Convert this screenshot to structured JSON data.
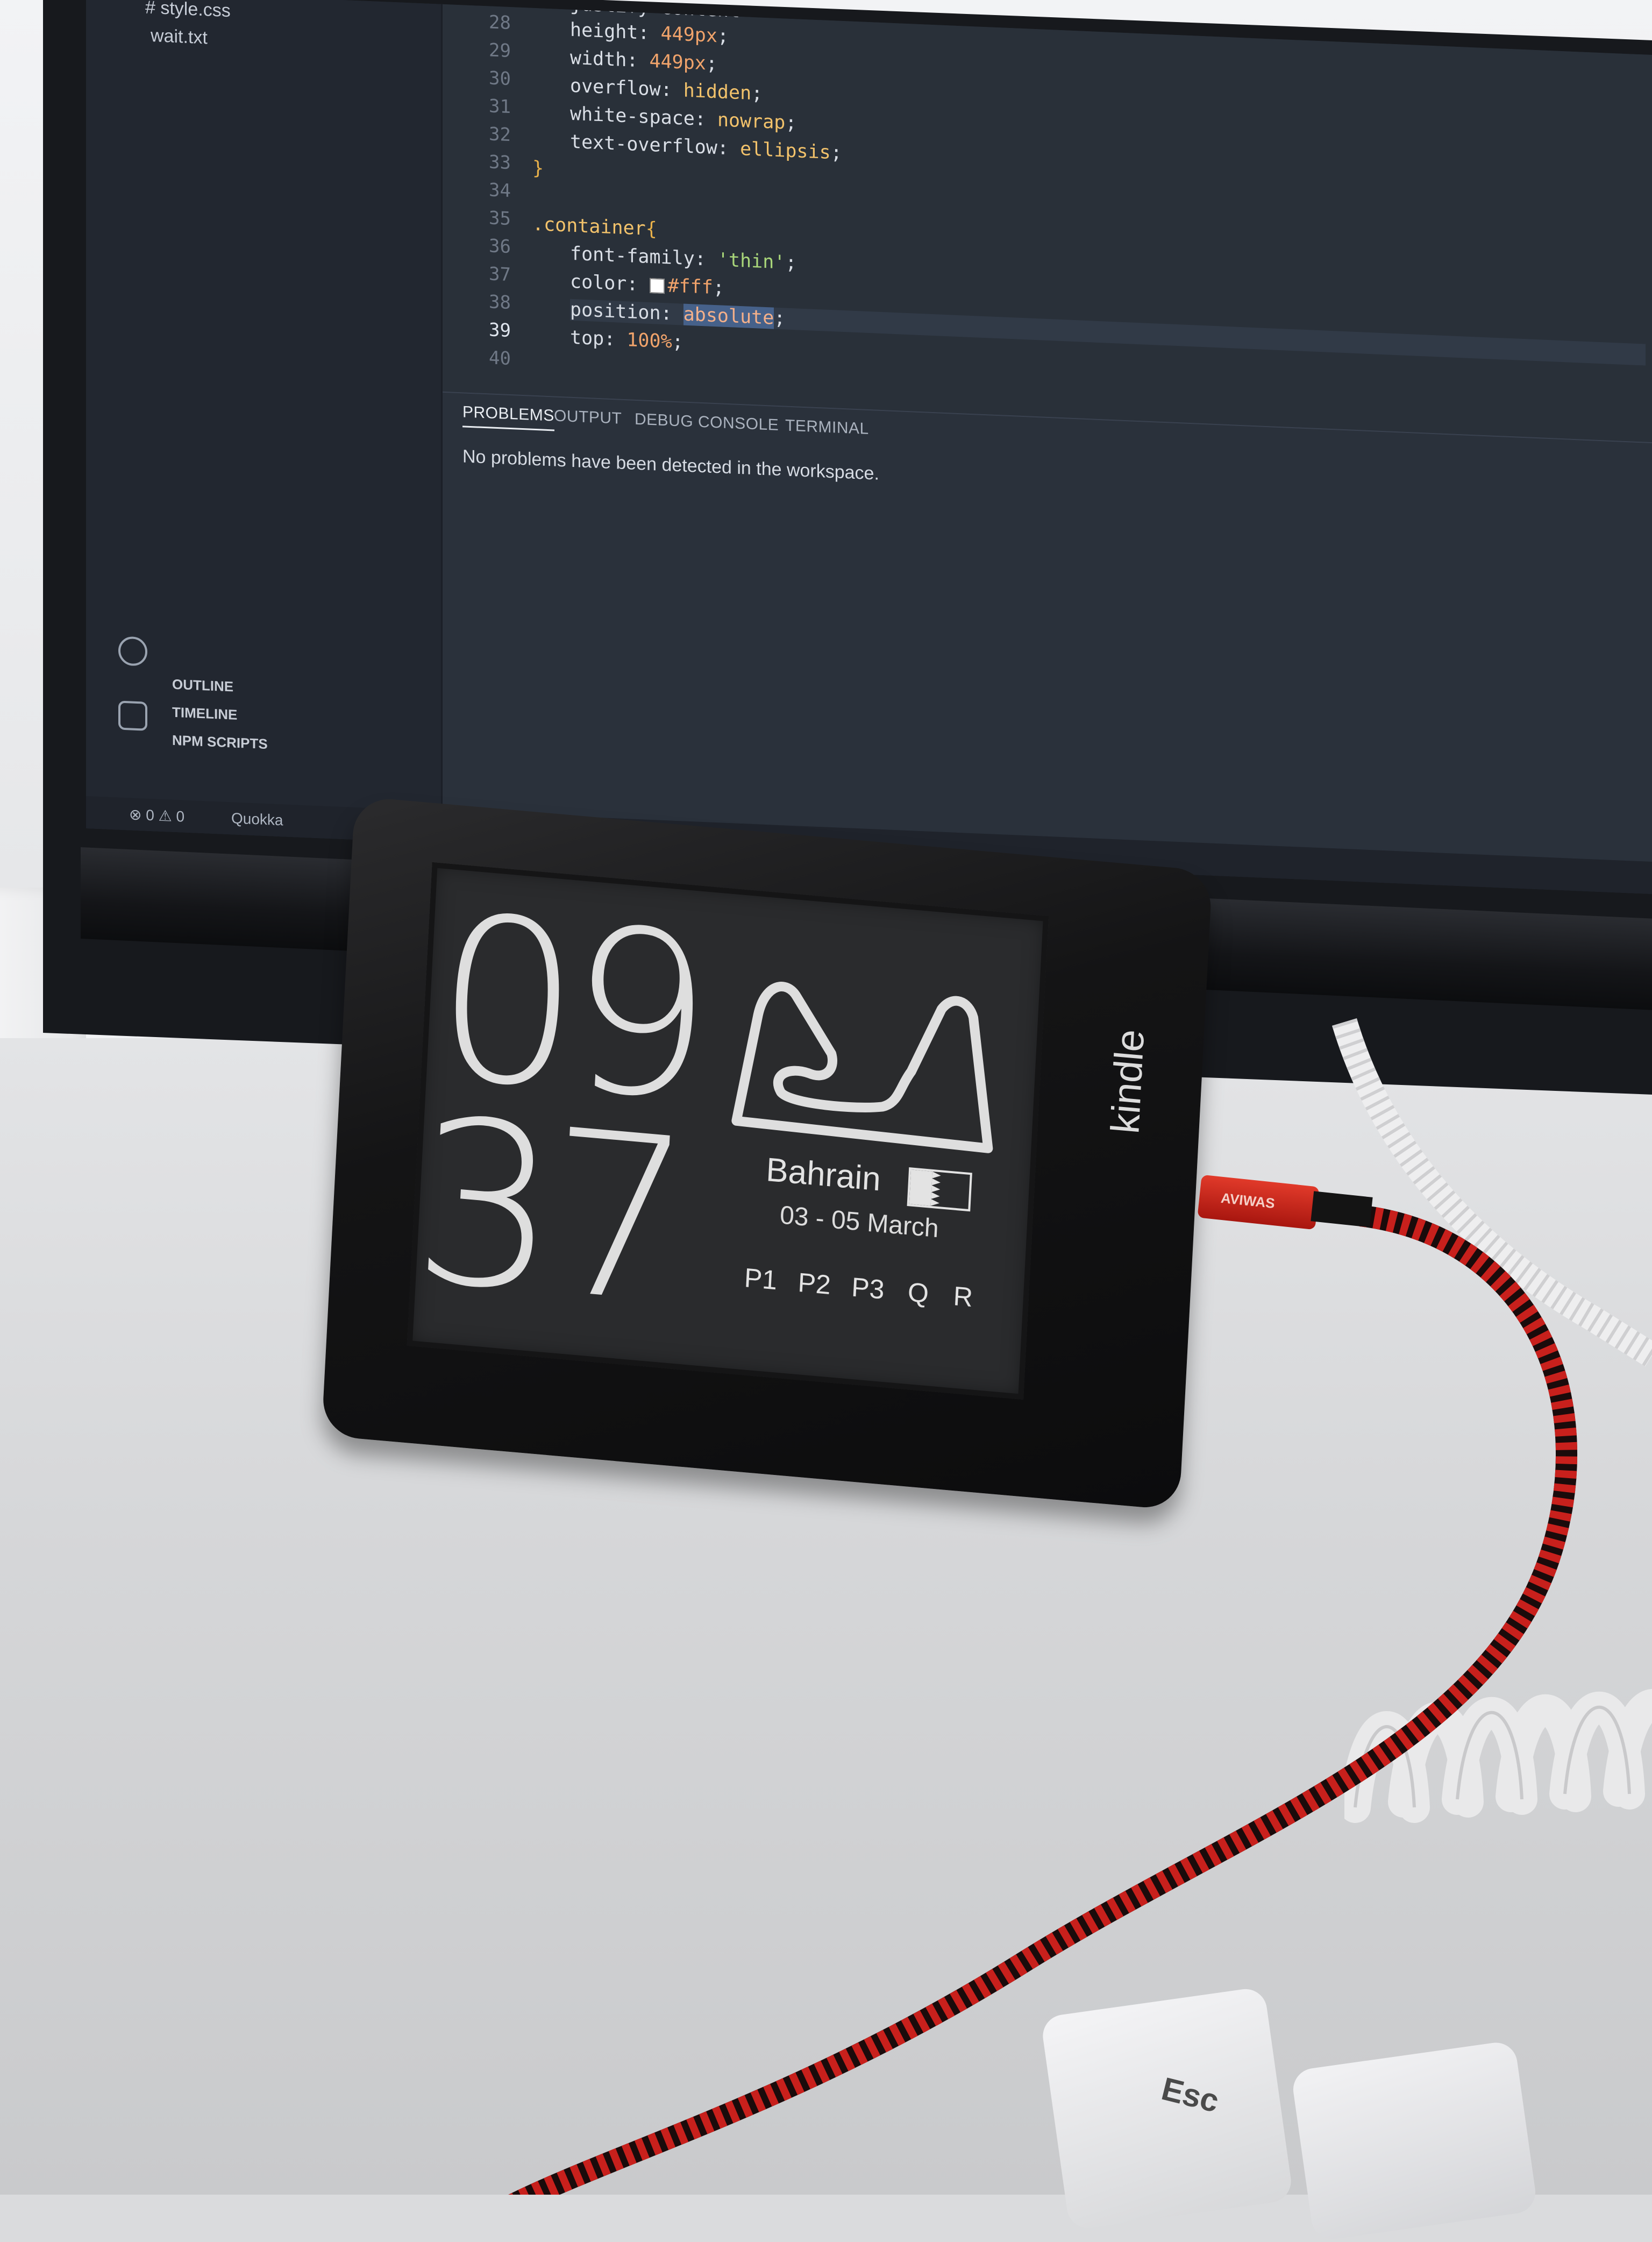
{
  "editor": {
    "files": [
      "# style.css",
      "wait.txt"
    ],
    "line_numbers": [
      "28",
      "29",
      "30",
      "31",
      "32",
      "33",
      "34",
      "35",
      "36",
      "37",
      "38",
      "39",
      "40"
    ],
    "active_line": "39",
    "code": {
      "l28": "justify-content",
      "l29_prop": "height: ",
      "l29_val": "449px",
      "l29_end": ";",
      "l30_prop": "width: ",
      "l30_val": "449px",
      "l30_end": ";",
      "l31_prop": "overflow: ",
      "l31_val": "hidden",
      "l31_end": ";",
      "l32_prop": "white-space: ",
      "l32_val": "nowrap",
      "l32_end": ";",
      "l33_prop": "text-overflow: ",
      "l33_val": "ellipsis",
      "l33_end": ";",
      "l34": "}",
      "l36_sel": ".container",
      "l36_brace": "{",
      "l37_prop": "font-family: ",
      "l37_val": "'thin'",
      "l37_end": ";",
      "l38_prop": "color: ",
      "l38_val": "#fff",
      "l38_end": ";",
      "l39_prop": "position: ",
      "l39_val": "absolute",
      "l39_end": ";",
      "l40_prop": "top: ",
      "l40_val": "100%",
      "l40_end": ";"
    },
    "panel_tabs": [
      "PROBLEMS",
      "OUTPUT",
      "DEBUG CONSOLE",
      "TERMINAL"
    ],
    "panel_message": "No problems have been detected in the workspace.",
    "sidebar_sections": [
      "OUTLINE",
      "TIMELINE",
      "NPM SCRIPTS"
    ],
    "status": {
      "counts": "⊗ 0 ⚠ 0",
      "extension": "Quokka"
    }
  },
  "kindle": {
    "brand": "kindle",
    "clock_hours": "09",
    "clock_minutes": "37",
    "race_location": "Bahrain",
    "race_dates": "03 - 05 March",
    "sessions": [
      "P1",
      "P2",
      "P3",
      "Q",
      "R"
    ]
  },
  "cable_brand": "AVIWAS",
  "keycap_legend": "Esc",
  "colors": {
    "cable_red": "#c8201c",
    "kindle_screen": "#2a2b2d",
    "editor_bg": "#293039"
  }
}
